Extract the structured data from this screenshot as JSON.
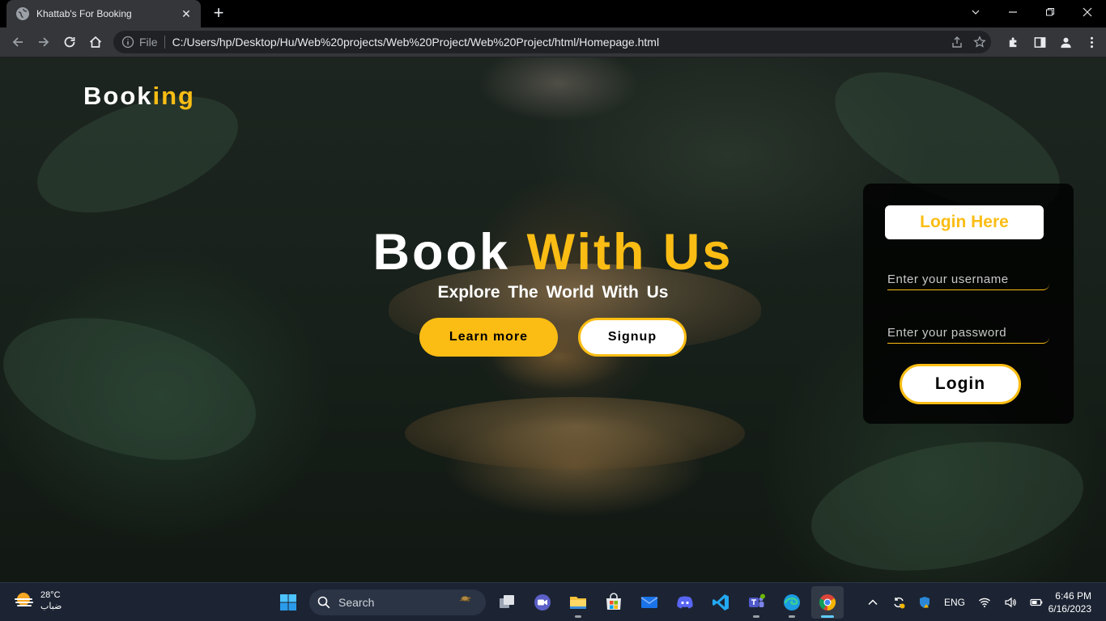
{
  "browser": {
    "tab_title": "Khattab's For Booking",
    "file_label": "File",
    "url": "C:/Users/hp/Desktop/Hu/Web%20projects/Web%20Project/Web%20Project/html/Homepage.html"
  },
  "site": {
    "logo_main": "Book",
    "logo_accent": "ing",
    "hero": {
      "title_main": "Book ",
      "title_accent": "With Us",
      "subtitle": "Explore The World With Us",
      "learn_more": "Learn more",
      "signup": "Signup"
    },
    "login": {
      "title": "Login Here",
      "username_placeholder": "Enter your username",
      "password_placeholder": "Enter your password",
      "button": "Login"
    },
    "colors": {
      "accent": "#fbbd14",
      "panel": "#000000"
    }
  },
  "taskbar": {
    "weather_temp": "28°C",
    "weather_desc": "ضباب",
    "search_label": "Search",
    "lang": "ENG",
    "time": "6:46 PM",
    "date": "6/16/2023",
    "apps": [
      "windows-start",
      "search",
      "task-view",
      "meet",
      "file-explorer",
      "microsoft-store",
      "mail",
      "discord",
      "vscode",
      "teams",
      "edge",
      "chrome"
    ]
  }
}
